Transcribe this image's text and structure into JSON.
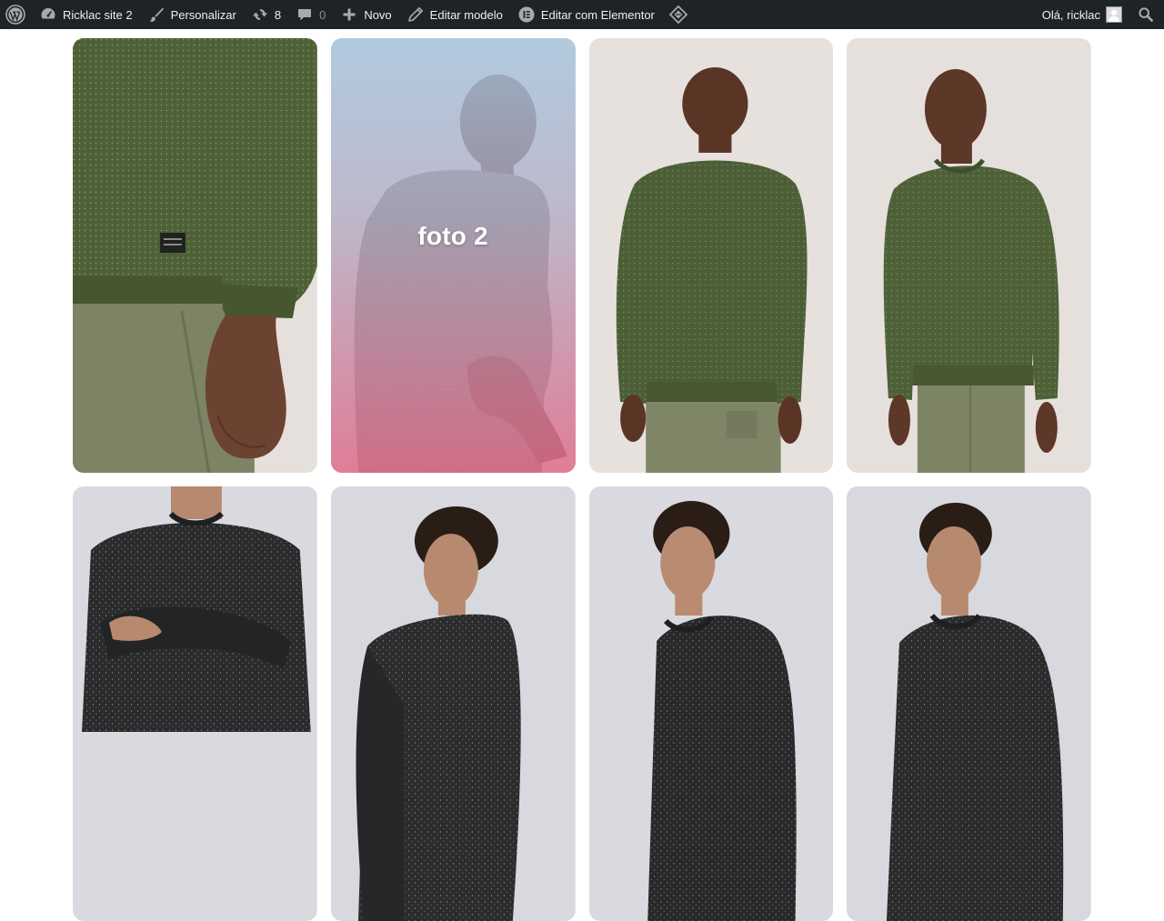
{
  "admin_bar": {
    "site_name": "Ricklac site 2",
    "customize": "Personalizar",
    "updates_count": "8",
    "comments_count": "0",
    "new": "Novo",
    "edit_template": "Editar modelo",
    "edit_elementor": "Editar com Elementor",
    "howdy": "Olá, ricklac",
    "colors": {
      "bar": "#1d2327",
      "text": "#f0f0f1",
      "icon": "#a7aaad"
    }
  },
  "gallery": {
    "tiles": [
      {
        "caption": "",
        "theme": "green-sweater"
      },
      {
        "caption": "foto 2",
        "theme": "green-sweater-hover"
      },
      {
        "caption": "",
        "theme": "green-sweater"
      },
      {
        "caption": "",
        "theme": "green-sweater"
      },
      {
        "caption": "",
        "theme": "black-speckled-sweater"
      },
      {
        "caption": "",
        "theme": "black-speckled-sweater"
      },
      {
        "caption": "",
        "theme": "black-speckled-sweater"
      },
      {
        "caption": "",
        "theme": "black-speckled-sweater"
      }
    ],
    "colors": {
      "green_sweater": "#4f6139",
      "pants": "#7d8465",
      "backdrop_warm": "#e6e1dc",
      "backdrop_cool": "#dcdde3",
      "black_sweater": "#2a2b2c",
      "skin_dark": "#6b4330",
      "skin_light": "#b78a70"
    }
  }
}
